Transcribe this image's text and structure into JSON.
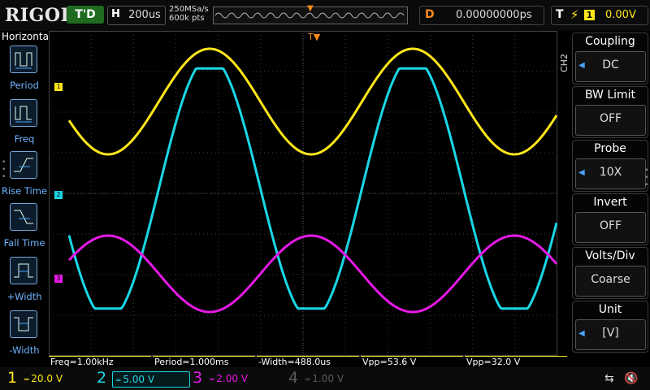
{
  "top": {
    "logo": "RIGOL",
    "run_status": "T'D",
    "horizontal_label": "H",
    "timebase": "200us",
    "sample_rate": "250MSa/s",
    "memory_depth": "600k pts",
    "delay_label": "D",
    "delay_value": "0.00000000ps",
    "trigger_label": "T",
    "trigger_edge_icon": "rising-edge-icon",
    "trigger_source": "1",
    "trigger_level": "0.00V"
  },
  "left_menu": {
    "title": "Horizontal",
    "items": [
      {
        "label": "Period",
        "icon": "period-icon"
      },
      {
        "label": "Freq",
        "icon": "freq-icon"
      },
      {
        "label": "Rise Time",
        "icon": "rise-time-icon"
      },
      {
        "label": "Fall Time",
        "icon": "fall-time-icon"
      },
      {
        "label": "+Width",
        "icon": "positive-width-icon"
      },
      {
        "label": "-Width",
        "icon": "negative-width-icon"
      }
    ]
  },
  "right_menu": {
    "tab": "CH2",
    "items": [
      {
        "title": "Coupling",
        "value": "DC"
      },
      {
        "title": "BW Limit",
        "value": "OFF"
      },
      {
        "title": "Probe",
        "value": "10X"
      },
      {
        "title": "Invert",
        "value": "OFF"
      },
      {
        "title": "Volts/Div",
        "value": "Coarse"
      },
      {
        "title": "Unit",
        "value": "[V]"
      }
    ]
  },
  "measurements": [
    {
      "text": "Freq=1.00kHz",
      "color": "#ffe61a"
    },
    {
      "text": "Period=1.000ms",
      "color": "#ffe61a"
    },
    {
      "text": "-Width=488.0us",
      "color": "#ffe61a"
    },
    {
      "text": "Vpp=53.6 V",
      "color": "#ffe61a"
    },
    {
      "text": "Vpp=32.0 V",
      "color": "#ffe61a"
    }
  ],
  "channels": [
    {
      "num": "1",
      "scale": "20.0 V",
      "color": "#ffe61a",
      "active": true
    },
    {
      "num": "2",
      "scale": "5.00 V",
      "color": "#19d7e6",
      "active": true
    },
    {
      "num": "3",
      "scale": "2.00 V",
      "color": "#e619e6",
      "active": true
    },
    {
      "num": "4",
      "scale": "1.00 V",
      "color": "#5a5a5a",
      "active": false
    }
  ],
  "markers": {
    "ch1": "1",
    "ch2": "2",
    "ch3": "3"
  },
  "colors": {
    "ch1": "#ffe61a",
    "ch2": "#19d7e6",
    "ch3": "#e619e6",
    "trigger": "#ff8c1a",
    "accent": "#4aa3ff"
  }
}
